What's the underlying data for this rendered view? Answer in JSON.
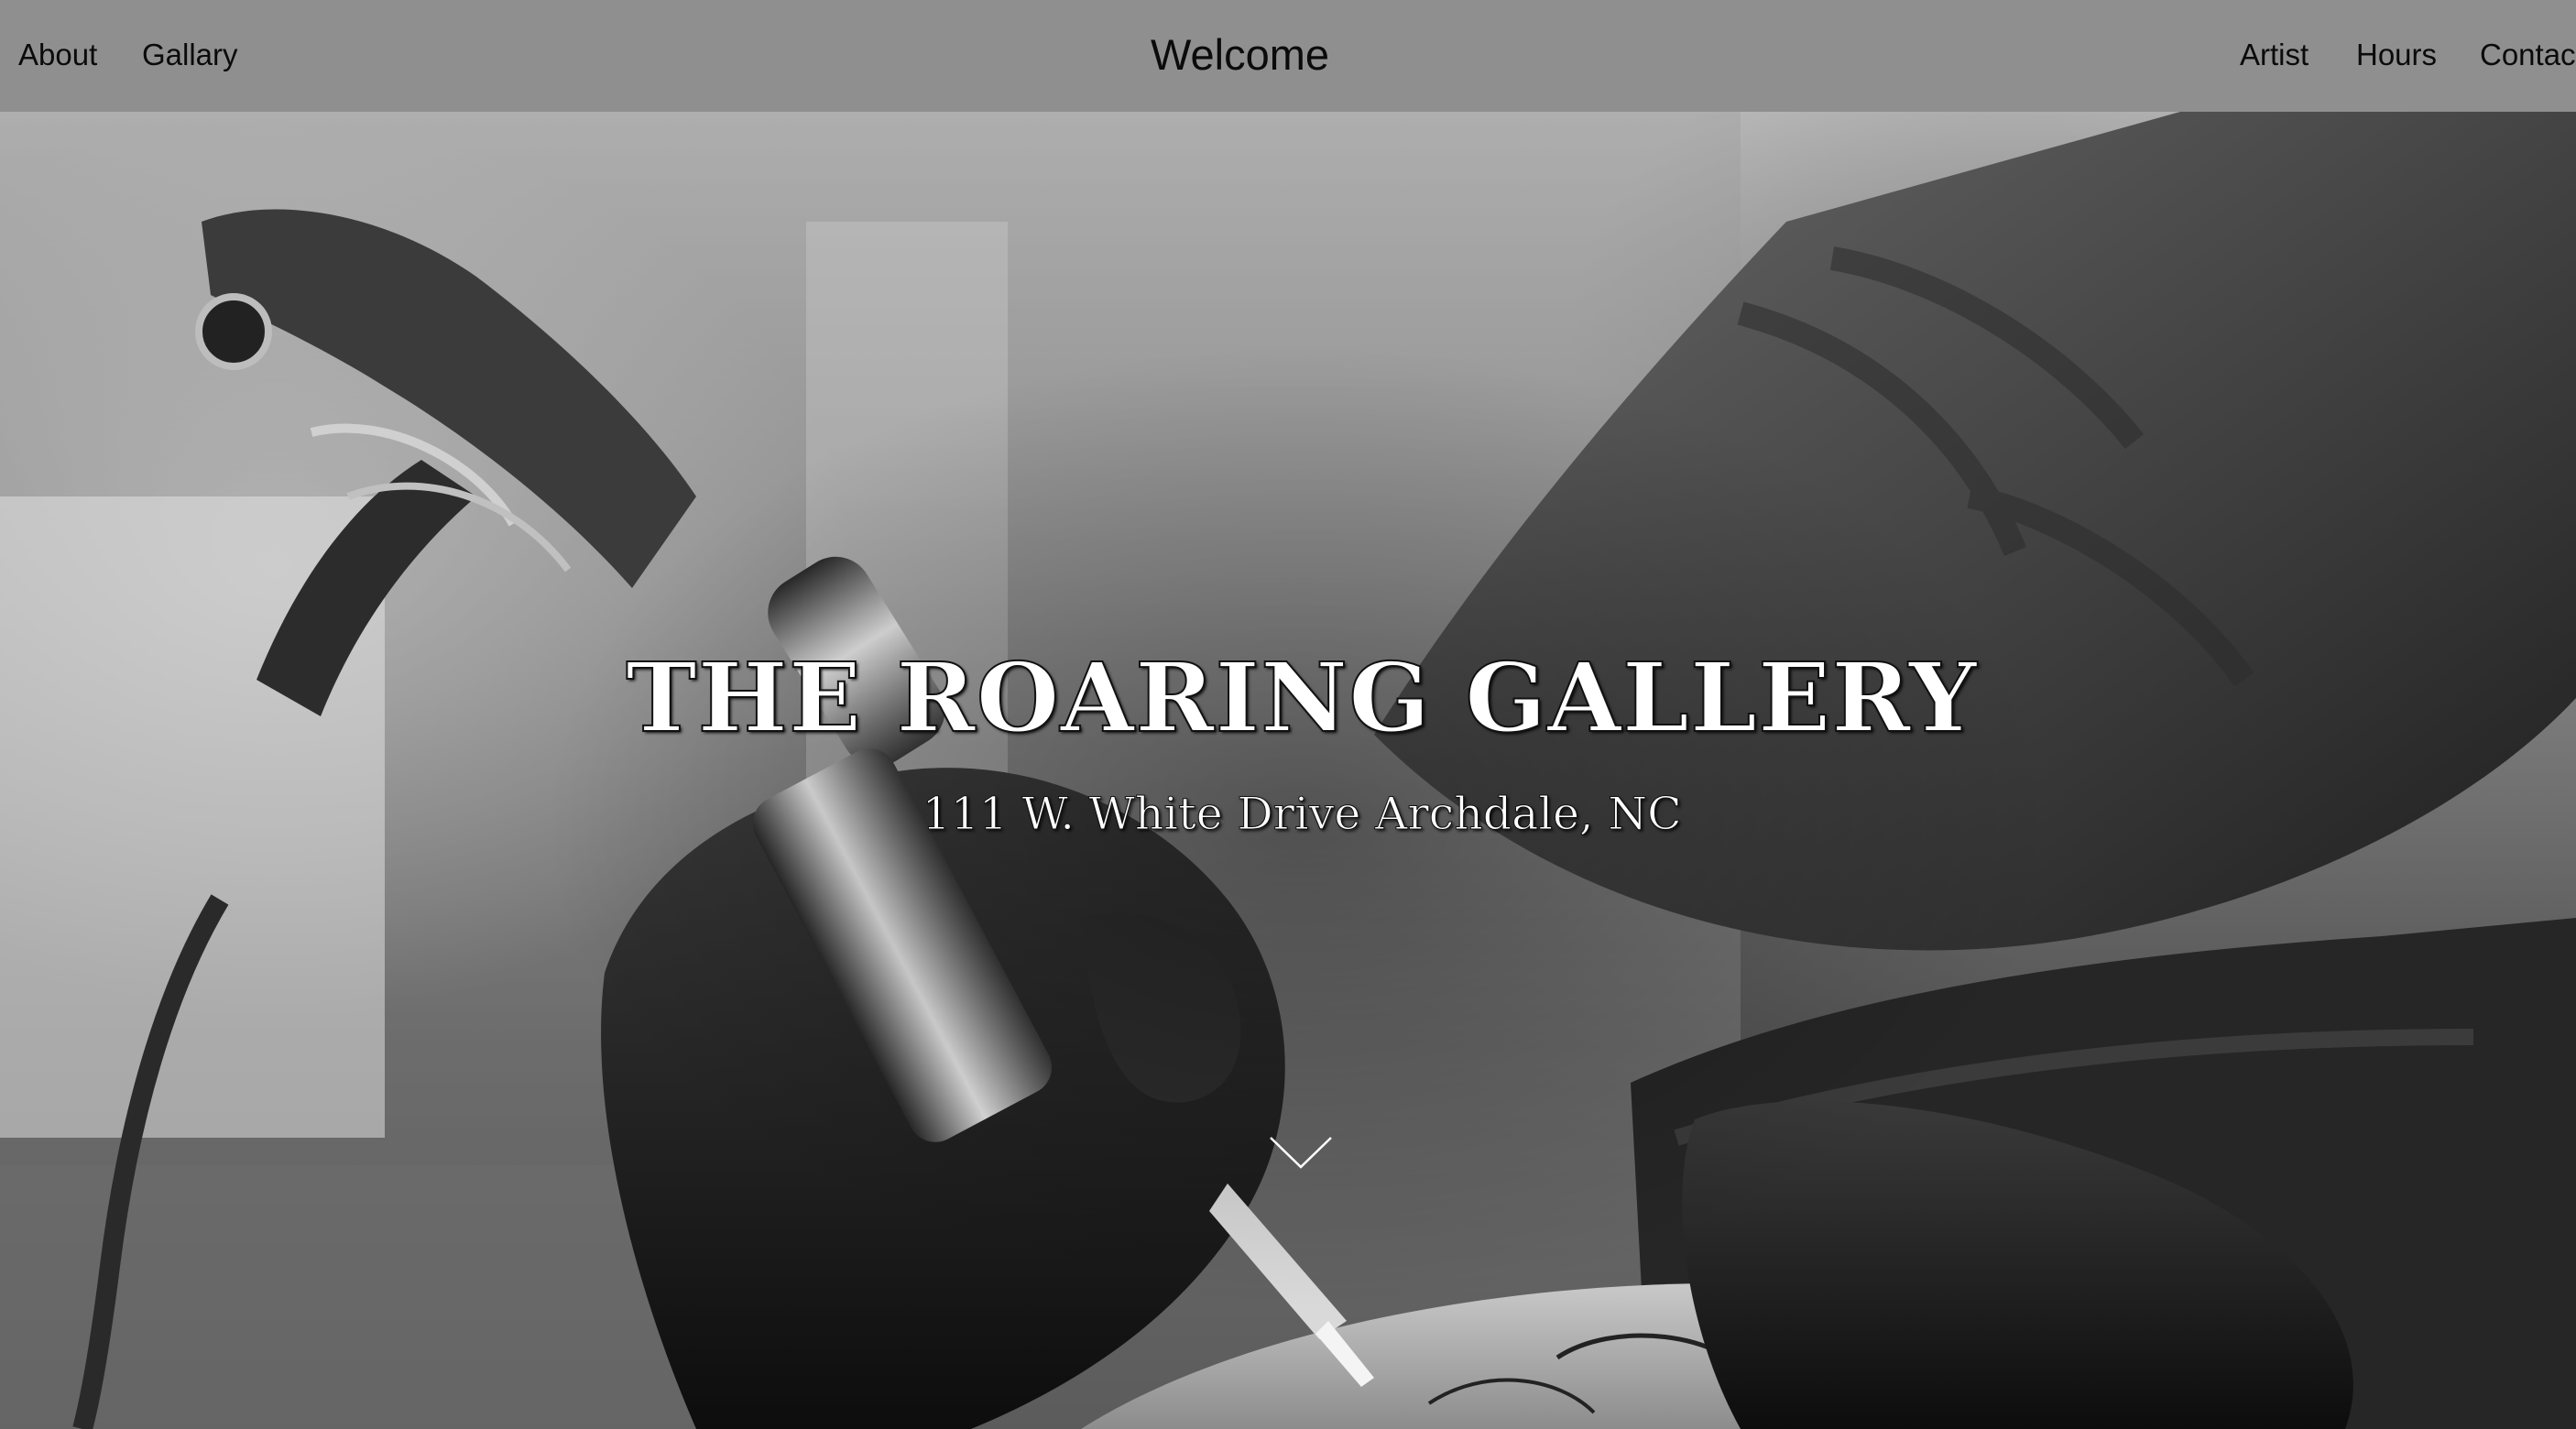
{
  "nav": {
    "left": [
      {
        "label": "About"
      },
      {
        "label": "Gallary"
      }
    ],
    "brand": "Welcome",
    "right": [
      {
        "label": "Artist"
      },
      {
        "label": "Hours"
      },
      {
        "label": "Contact"
      }
    ]
  },
  "hero": {
    "title": "THE ROARING GALLERY",
    "address": "111 W. White Drive Archdale, NC",
    "background_image": "black-and-white-tattoo-machine-photo",
    "scroll_icon": "chevron-down-icon"
  },
  "colors": {
    "topbar": "#8f8f8f",
    "nav_text": "#0b0b0b",
    "hero_text": "#ffffff"
  }
}
